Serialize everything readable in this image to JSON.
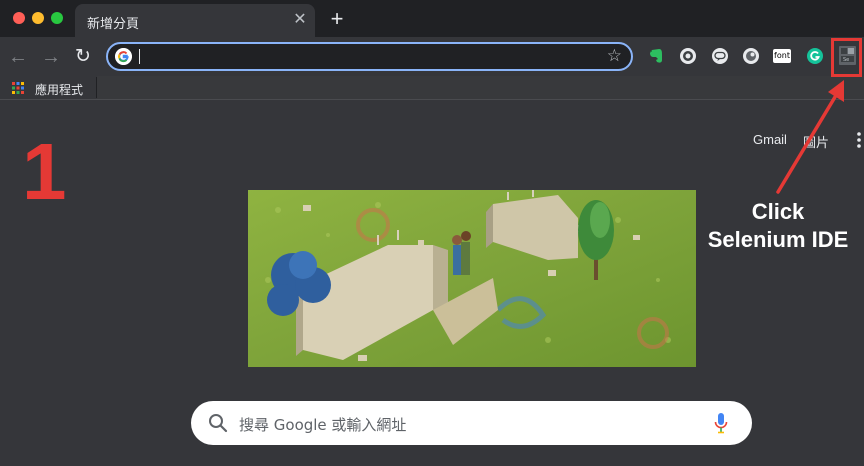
{
  "window": {
    "tab_title": "新增分頁",
    "new_tab_symbol": "+",
    "close_symbol": "✕"
  },
  "toolbar": {
    "back_symbol": "←",
    "forward_symbol": "→",
    "reload_symbol": "↻",
    "address_value": "",
    "bookmark_star": "☆",
    "extensions": [
      {
        "name": "evernote-icon"
      },
      {
        "name": "circle-extension-icon"
      },
      {
        "name": "line-icon"
      },
      {
        "name": "disc-extension-icon"
      },
      {
        "name": "font-extension",
        "label": "font"
      },
      {
        "name": "grammarly-icon"
      },
      {
        "name": "selenium-ide-icon"
      }
    ]
  },
  "bookmarks_bar": {
    "apps_label": "應用程式"
  },
  "newtab": {
    "gmail_label": "Gmail",
    "images_label": "圖片",
    "search_placeholder": "搜尋 Google 或輸入網址"
  },
  "annotation": {
    "step_number": "1",
    "line1": "Click",
    "line2": "Selenium IDE",
    "color": "#e53935"
  },
  "colors": {
    "accent": "#8ab4f8",
    "tab_strip": "#202124",
    "toolbar": "#35363a"
  }
}
